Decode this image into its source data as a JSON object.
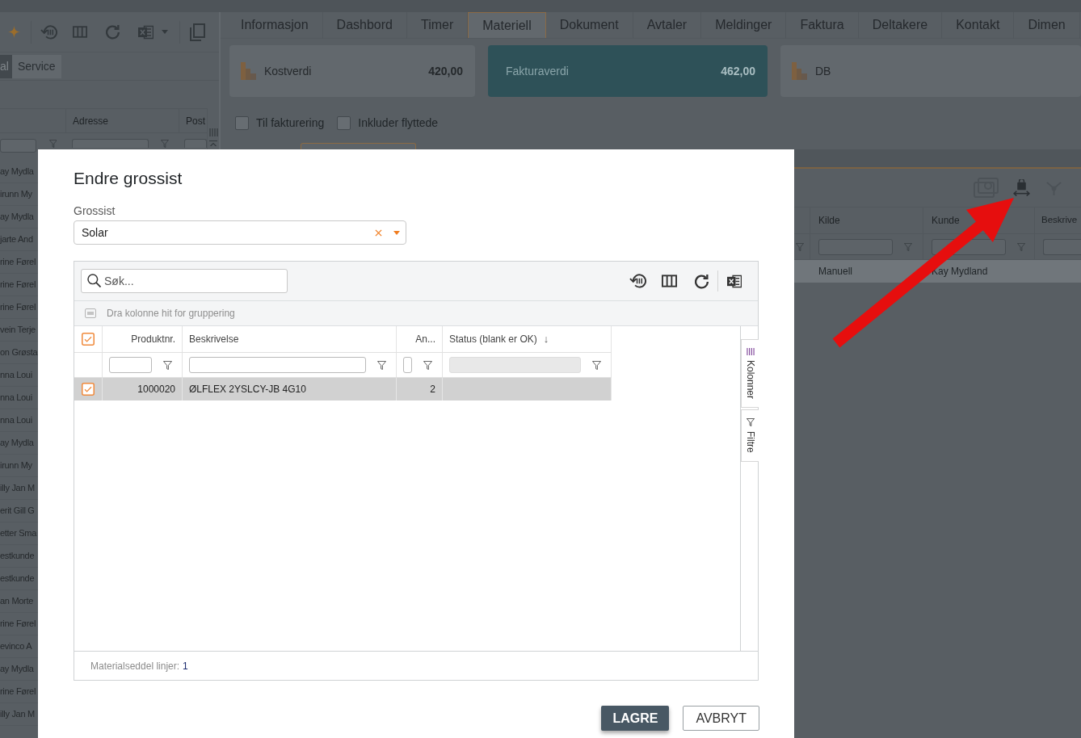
{
  "left_panel": {
    "tabs": [
      {
        "label": "al",
        "selected": true
      },
      {
        "label": "Service",
        "selected": false
      }
    ],
    "columns": [
      "Adresse",
      "Post"
    ],
    "rows": [
      "ay Mydla",
      "irunn My",
      "ay Mydla",
      "jarte And",
      "rine Førel",
      "rine Førel",
      "rine Førel",
      "vein Terje",
      "on Grøsta",
      "nna Loui",
      "nna Loui",
      "nna Loui",
      "ay Mydla",
      "irunn My",
      "illy Jan M",
      "erit Gill G",
      "etter Sma",
      "estkunde",
      "estkunde",
      "an Morte",
      "rine Førel",
      "evinco A",
      "ay Mydla",
      "rine Førel",
      "illy Jan M"
    ]
  },
  "main_tabs": [
    {
      "label": "Informasjon",
      "selected": false
    },
    {
      "label": "Dashbord",
      "selected": false
    },
    {
      "label": "Timer",
      "selected": false
    },
    {
      "label": "Materiell",
      "selected": true
    },
    {
      "label": "Dokument",
      "selected": false
    },
    {
      "label": "Avtaler",
      "selected": false
    },
    {
      "label": "Meldinger",
      "selected": false
    },
    {
      "label": "Faktura",
      "selected": false
    },
    {
      "label": "Deltakere",
      "selected": false
    },
    {
      "label": "Kontakt",
      "selected": false
    },
    {
      "label": "Dimen",
      "selected": false
    }
  ],
  "summary_cards": [
    {
      "label": "Kostverdi",
      "value": "420,00",
      "selected": false
    },
    {
      "label": "Fakturaverdi",
      "value": "462,00",
      "selected": true
    },
    {
      "label": "DB",
      "selected": false
    }
  ],
  "options": [
    {
      "label": "Til fakturering",
      "checked": false
    },
    {
      "label": "Inkluder flyttede",
      "checked": false
    }
  ],
  "background_grid": {
    "columns": [
      "Kilde",
      "Kunde",
      "Beskrive"
    ],
    "rows": [
      {
        "cells": [
          "Manuell",
          "Kay Mydland"
        ],
        "selected": true
      }
    ]
  },
  "dialog": {
    "title": "Endre grossist",
    "grossist": {
      "label": "Grossist",
      "value": "Solar"
    },
    "grid": {
      "search_placeholder": "Søk...",
      "group_hint": "Dra kolonne hit for gruppering",
      "select_all": true,
      "columns": [
        {
          "label": "Produktnr.",
          "filter_disabled": false
        },
        {
          "label": "Beskrivelse",
          "filter_disabled": false
        },
        {
          "label": "An...",
          "filter_disabled": false
        },
        {
          "label": "Status (blank er OK)",
          "sort_arrow": "↓",
          "filter_disabled": true
        }
      ],
      "rows": [
        {
          "checked": true,
          "selected": true,
          "cells": [
            "1000020",
            "ØLFLEX 2YSLCY-JB 4G10",
            "2"
          ]
        }
      ],
      "side_tabs": [
        {
          "label": "Kolonner",
          "kind": "columns"
        },
        {
          "label": "Filtre",
          "kind": "filters"
        }
      ],
      "footer": {
        "label": "Materialseddel linjer:",
        "count": "1"
      }
    },
    "buttons": [
      {
        "label": "LAGRE",
        "kind": "primary"
      },
      {
        "label": "AVBRYT",
        "kind": "secondary"
      }
    ]
  }
}
